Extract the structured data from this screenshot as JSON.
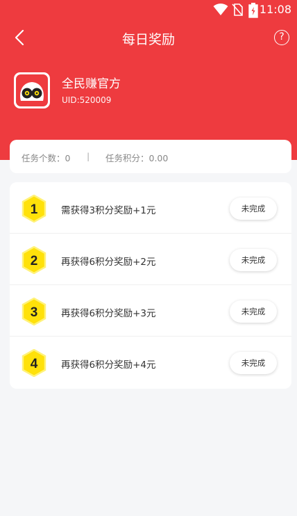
{
  "status_bar": {
    "time": "11:08"
  },
  "nav": {
    "title": "每日奖励",
    "help": "?"
  },
  "profile": {
    "name": "全民赚官方",
    "uid": "UID:520009"
  },
  "stats": {
    "task_count": "任务个数：0",
    "divider": "|",
    "task_points": "任务积分：0.00"
  },
  "tasks": [
    {
      "number": "1",
      "text": "需获得3积分奖励+1元",
      "status": "未完成"
    },
    {
      "number": "2",
      "text": "再获得6积分奖励+2元",
      "status": "未完成"
    },
    {
      "number": "3",
      "text": "再获得6积分奖励+3元",
      "status": "未完成"
    },
    {
      "number": "4",
      "text": "再获得6积分奖励+4元",
      "status": "未完成"
    }
  ],
  "colors": {
    "brand_red": "#ee3b3f",
    "badge_yellow": "#ffe10a",
    "badge_border": "#fff27a"
  },
  "icons": [
    "wifi-icon",
    "no-sim-icon",
    "battery-icon",
    "back-arrow-icon",
    "help-icon",
    "app-logo-icon",
    "hexagon-badge-icon"
  ]
}
